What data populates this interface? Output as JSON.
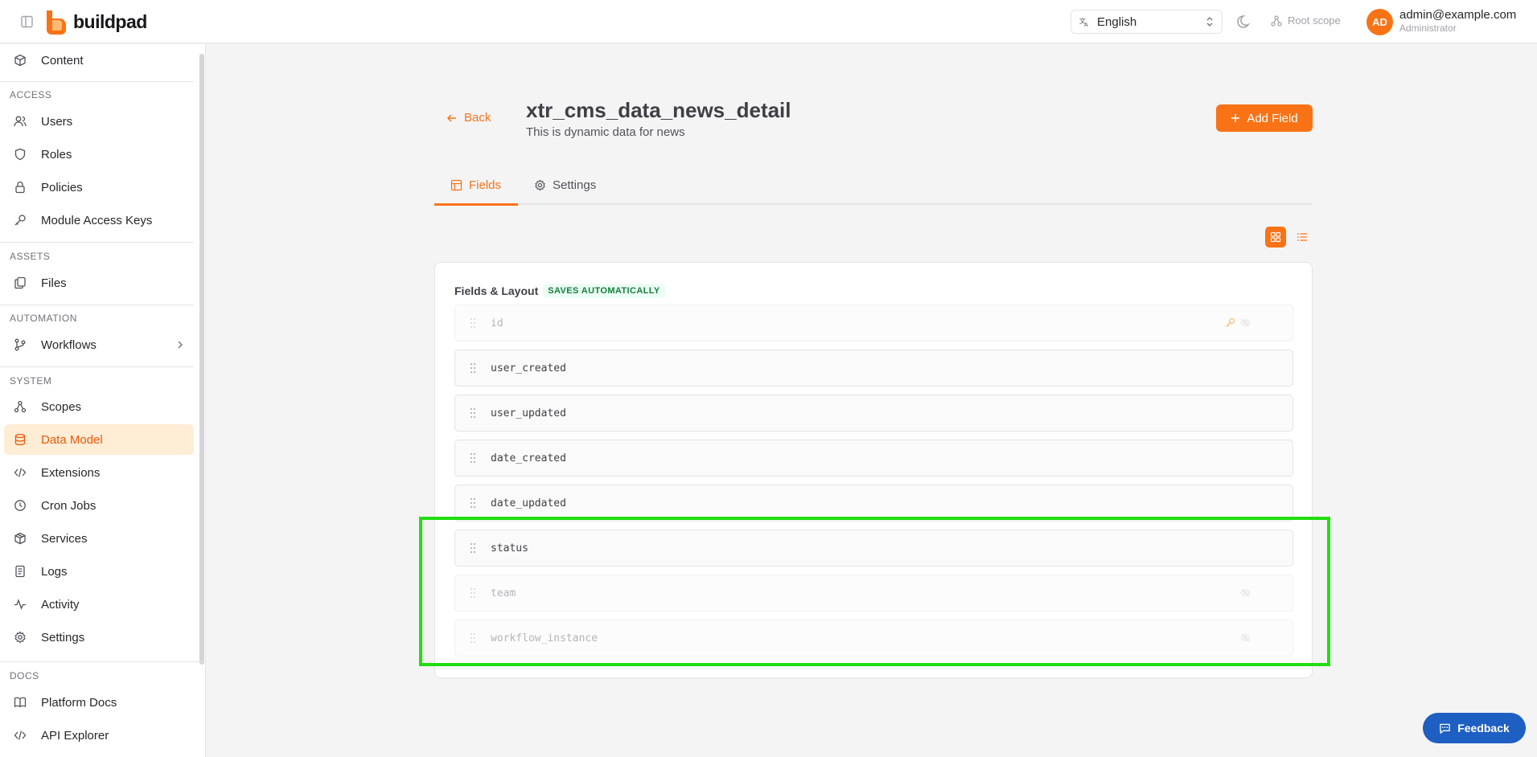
{
  "app": {
    "brand": "buildpad",
    "accent": "#f97316"
  },
  "header": {
    "language": "English",
    "scope": "Root scope",
    "user": {
      "initials": "AD",
      "email": "admin@example.com",
      "role": "Administrator"
    }
  },
  "sidebar": {
    "top": {
      "label": "Content"
    },
    "sections": {
      "access": "ACCESS",
      "assets": "ASSETS",
      "automation": "AUTOMATION",
      "system": "SYSTEM",
      "docs": "DOCS"
    },
    "items": {
      "users": "Users",
      "roles": "Roles",
      "policies": "Policies",
      "module_access_keys": "Module Access Keys",
      "files": "Files",
      "workflows": "Workflows",
      "scopes": "Scopes",
      "data_model": "Data Model",
      "extensions": "Extensions",
      "cron_jobs": "Cron Jobs",
      "services": "Services",
      "logs": "Logs",
      "activity": "Activity",
      "settings": "Settings",
      "platform_docs": "Platform Docs",
      "api_explorer": "API Explorer"
    },
    "active": "Data Model"
  },
  "main": {
    "back_label": "Back",
    "title": "xtr_cms_data_news_detail",
    "subtitle": "This is dynamic data for news",
    "add_field_label": "Add Field",
    "tabs": {
      "fields": "Fields",
      "settings": "Settings"
    },
    "active_tab": "Fields",
    "card": {
      "title": "Fields & Layout",
      "badge": "SAVES AUTOMATICALLY",
      "fields": [
        {
          "name": "id",
          "hidden": true,
          "primary_key": true
        },
        {
          "name": "user_created",
          "hidden": false
        },
        {
          "name": "user_updated",
          "hidden": false
        },
        {
          "name": "date_created",
          "hidden": false
        },
        {
          "name": "date_updated",
          "hidden": false
        },
        {
          "name": "status",
          "hidden": false
        },
        {
          "name": "team",
          "hidden": true
        },
        {
          "name": "workflow_instance",
          "hidden": true
        }
      ]
    }
  },
  "feedback_label": "Feedback",
  "icons": [
    "sidebar-toggle-icon",
    "language-icon",
    "moon-icon",
    "scope-icon",
    "arrow-left-icon",
    "plus-icon",
    "table-icon",
    "gear-icon",
    "grid-icon",
    "list-icon",
    "grip-icon",
    "key-icon",
    "eye-off-icon",
    "chat-icon"
  ]
}
